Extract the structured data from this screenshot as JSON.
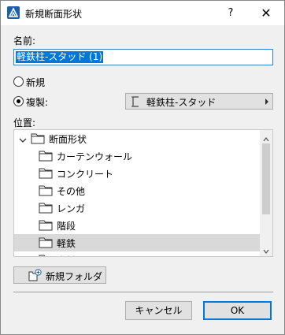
{
  "window": {
    "title": "新規断面形状",
    "help_label": "?",
    "close_label": "✕"
  },
  "name": {
    "label": "名前:",
    "value": "軽鉄柱-スタッド (1)"
  },
  "options": {
    "new_label": "新規",
    "duplicate_label": "複製:",
    "selected": "duplicate",
    "duplicate_source": "軽鉄柱-スタッド"
  },
  "location": {
    "label": "位置:",
    "tree": {
      "root": "断面形状",
      "items": [
        "カーテンウォール",
        "コンクリート",
        "その他",
        "レンガ",
        "階段",
        "軽鉄",
        "木材"
      ],
      "selected": "軽鉄"
    }
  },
  "buttons": {
    "new_folder": "新規フォルダ",
    "cancel": "キャンセル",
    "ok": "OK"
  },
  "colors": {
    "accent": "#0078d7",
    "selection_row": "#d9d9d9"
  }
}
